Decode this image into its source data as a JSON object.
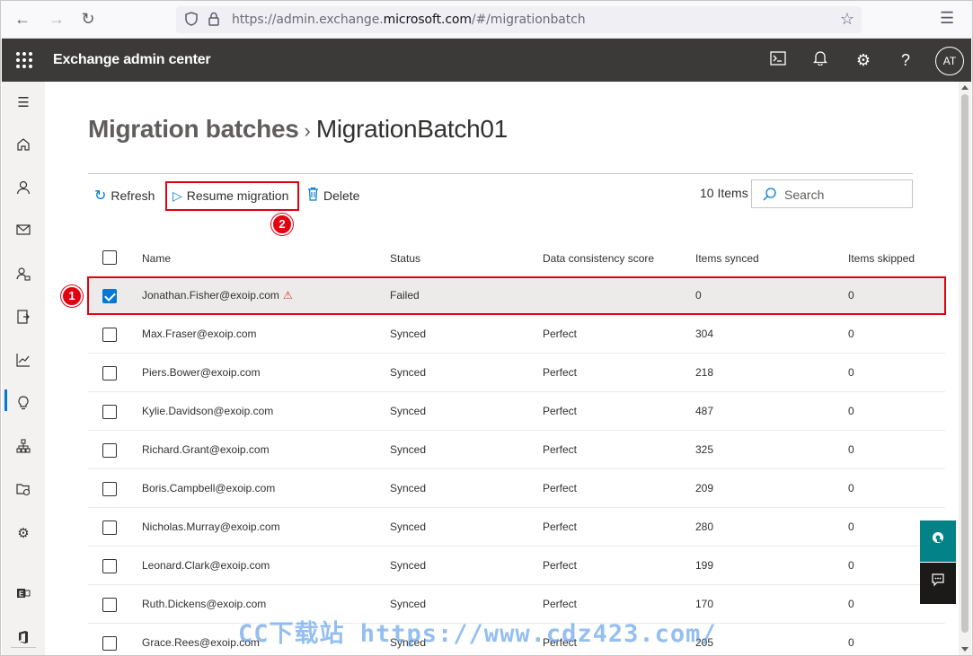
{
  "browser": {
    "url_prefix": "https://admin.exchange.",
    "url_domain": "microsoft.com",
    "url_suffix": "/#/migrationbatch"
  },
  "app": {
    "title": "Exchange admin center",
    "avatar_initials": "AT"
  },
  "page": {
    "title": "Migration batches",
    "separator": "›",
    "subtitle": "MigrationBatch01"
  },
  "toolbar": {
    "refresh_label": "Refresh",
    "resume_label": "Resume migration",
    "delete_label": "Delete",
    "item_count": "10 Items",
    "search_placeholder": "Search"
  },
  "annotations": {
    "badge_1": "1",
    "badge_2": "2"
  },
  "table": {
    "headers": {
      "name": "Name",
      "status": "Status",
      "consistency": "Data consistency score",
      "synced": "Items synced",
      "skipped": "Items skipped"
    },
    "rows": [
      {
        "name": "Jonathan.Fisher@exoip.com",
        "status": "Failed",
        "consistency": "",
        "synced": "0",
        "skipped": "0",
        "checked": true
      },
      {
        "name": "Max.Fraser@exoip.com",
        "status": "Synced",
        "consistency": "Perfect",
        "synced": "304",
        "skipped": "0"
      },
      {
        "name": "Piers.Bower@exoip.com",
        "status": "Synced",
        "consistency": "Perfect",
        "synced": "218",
        "skipped": "0"
      },
      {
        "name": "Kylie.Davidson@exoip.com",
        "status": "Synced",
        "consistency": "Perfect",
        "synced": "487",
        "skipped": "0"
      },
      {
        "name": "Richard.Grant@exoip.com",
        "status": "Synced",
        "consistency": "Perfect",
        "synced": "325",
        "skipped": "0"
      },
      {
        "name": "Boris.Campbell@exoip.com",
        "status": "Synced",
        "consistency": "Perfect",
        "synced": "209",
        "skipped": "0"
      },
      {
        "name": "Nicholas.Murray@exoip.com",
        "status": "Synced",
        "consistency": "Perfect",
        "synced": "280",
        "skipped": "0"
      },
      {
        "name": "Leonard.Clark@exoip.com",
        "status": "Synced",
        "consistency": "Perfect",
        "synced": "199",
        "skipped": "0"
      },
      {
        "name": "Ruth.Dickens@exoip.com",
        "status": "Synced",
        "consistency": "Perfect",
        "synced": "170",
        "skipped": "0"
      },
      {
        "name": "Grace.Rees@exoip.com",
        "status": "Synced",
        "consistency": "Perfect",
        "synced": "205",
        "skipped": "0"
      }
    ]
  },
  "watermark": "CC下载站 https://www.cdz423.com/",
  "colors": {
    "header_bg": "#3b3a39",
    "accent": "#0078d4",
    "highlight_red": "#e3000f",
    "float_btn": "#038387"
  }
}
